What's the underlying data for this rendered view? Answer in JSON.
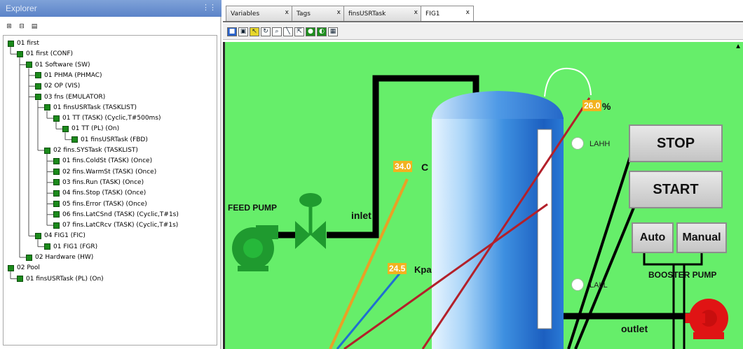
{
  "explorer": {
    "title": "Explorer",
    "toolbar": [
      "expand-icon",
      "collapse-icon",
      "properties-icon"
    ],
    "tree": [
      {
        "label": "01 first",
        "depth": 0
      },
      {
        "label": "01 first (CONF)",
        "depth": 1
      },
      {
        "label": "01 Software (SW)",
        "depth": 2
      },
      {
        "label": "01 PHMA (PHMAC)",
        "depth": 3
      },
      {
        "label": "02 OP (VIS)",
        "depth": 3
      },
      {
        "label": "03 fns (EMULATOR)",
        "depth": 3
      },
      {
        "label": "01 finsUSRTask (TASKLIST)",
        "depth": 4
      },
      {
        "label": "01 TT (TASK) (Cyclic,T#500ms)",
        "depth": 5
      },
      {
        "label": "01 TT (PL) (On)",
        "depth": 6
      },
      {
        "label": "01 finsUSRTask (FBD)",
        "depth": 7
      },
      {
        "label": "02 fins.SYSTask (TASKLIST)",
        "depth": 4
      },
      {
        "label": "01 fins.ColdSt (TASK) (Once)",
        "depth": 5
      },
      {
        "label": "02 fins.WarmSt (TASK) (Once)",
        "depth": 5
      },
      {
        "label": "03 fins.Run (TASK) (Once)",
        "depth": 5
      },
      {
        "label": "04 fins.Stop (TASK) (Once)",
        "depth": 5
      },
      {
        "label": "05 fins.Error (TASK) (Once)",
        "depth": 5
      },
      {
        "label": "06 fins.LatCSnd (TASK) (Cyclic,T#1s)",
        "depth": 5
      },
      {
        "label": "07 fins.LatCRcv (TASK) (Cyclic,T#1s)",
        "depth": 5
      },
      {
        "label": "04 FIG1 (FIC)",
        "depth": 3
      },
      {
        "label": "01 FIG1 (FGR)",
        "depth": 4
      },
      {
        "label": "02 Hardware (HW)",
        "depth": 2
      },
      {
        "label": "02 Pool",
        "depth": 0
      },
      {
        "label": "01 finsUSRTask (PL) (On)",
        "depth": 1
      }
    ]
  },
  "tabs": [
    {
      "label": "Variables",
      "close": "x"
    },
    {
      "label": "Tags",
      "close": "x"
    },
    {
      "label": "finsUSRTask",
      "close": "x"
    },
    {
      "label": "FIG1",
      "close": "x"
    }
  ],
  "editor_toolbar": [
    "save-icon",
    "print-icon",
    "pointer-icon",
    "rotate-icon",
    "zoom-icon",
    "line-icon",
    "select-icon",
    "fill-icon",
    "color-icon",
    "grid-icon"
  ],
  "canvas": {
    "labels": {
      "feed_pump": "FEED PUMP",
      "inlet": "inlet",
      "outlet": "outlet",
      "booster_pump": "BOOSTER PUMP",
      "lahh": "LAHH",
      "lall": "LALL",
      "temp_unit": "C",
      "pressure_unit": "Kpa",
      "level_unit": "%"
    },
    "values": {
      "temperature": "34.0",
      "pressure": "24.5",
      "level": "26.0"
    },
    "buttons": {
      "stop": "STOP",
      "start": "START",
      "auto": "Auto",
      "manual": "Manual"
    },
    "scroll_arrow": "▲",
    "colors": {
      "background": "#66ee6a",
      "tank": "#2f7fd6",
      "pump": "#1f9a2f",
      "booster": "#e01414",
      "value_box": "#f2b21f",
      "wire_red": "#b3202a",
      "wire_orange": "#e8a126",
      "wire_blue": "#1f6fd1"
    }
  }
}
